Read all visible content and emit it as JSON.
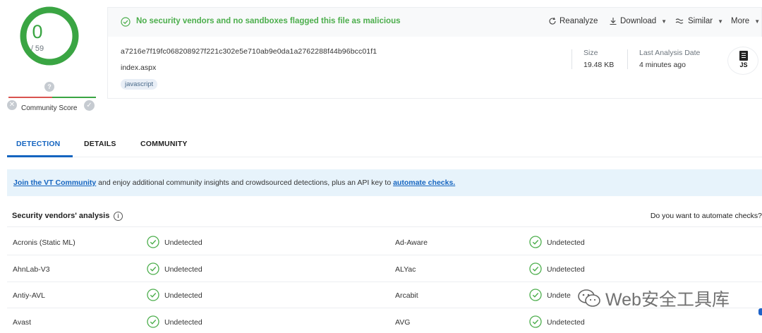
{
  "score": {
    "detections": "0",
    "total": "/ 59",
    "community_label": "Community Score",
    "colors": {
      "gauge": "#3aa543",
      "bad": "#d9534f"
    }
  },
  "banner": {
    "message": "No security vendors and no sandboxes flagged this file as malicious",
    "actions": {
      "reanalyze": "Reanalyze",
      "download": "Download",
      "similar": "Similar",
      "more": "More"
    }
  },
  "file": {
    "hash": "a7216e7f19fc068208927f221c302e5e710ab9e0da1a2762288f44b96bcc01f1",
    "name": "index.aspx",
    "tag": "javascript",
    "size_label": "Size",
    "size_value": "19.48 KB",
    "last_analysis_label": "Last Analysis Date",
    "last_analysis_value": "4 minutes ago",
    "type_badge": "JS"
  },
  "tabs": [
    "DETECTION",
    "DETAILS",
    "COMMUNITY"
  ],
  "cta": {
    "join_link": "Join the VT Community",
    "middle_text": " and enjoy additional community insights and crowdsourced detections, plus an API key to ",
    "automate_link": "automate checks."
  },
  "vendors": {
    "title": "Security vendors' analysis",
    "automate_question": "Do you want to automate checks?",
    "rows": [
      {
        "left": {
          "name": "Acronis (Static ML)",
          "result": "Undetected"
        },
        "right": {
          "name": "Ad-Aware",
          "result": "Undetected"
        }
      },
      {
        "left": {
          "name": "AhnLab-V3",
          "result": "Undetected"
        },
        "right": {
          "name": "ALYac",
          "result": "Undetected"
        }
      },
      {
        "left": {
          "name": "Antiy-AVL",
          "result": "Undetected"
        },
        "right": {
          "name": "Arcabit",
          "result": "Undete"
        }
      },
      {
        "left": {
          "name": "Avast",
          "result": "Undetected"
        },
        "right": {
          "name": "AVG",
          "result": "Undetected"
        }
      }
    ]
  },
  "watermark": "Web安全工具库"
}
